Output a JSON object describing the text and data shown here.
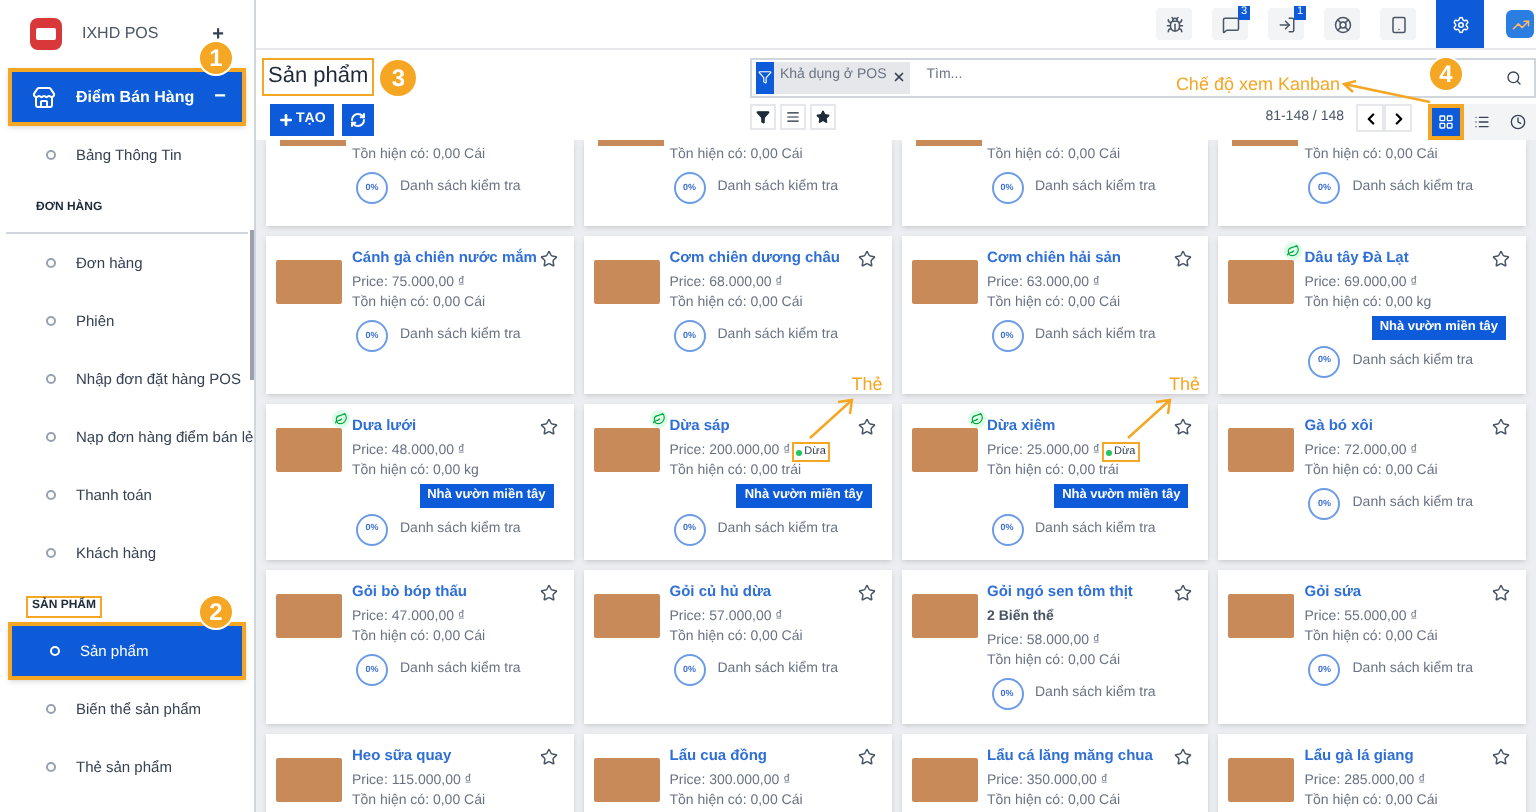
{
  "sidebar": {
    "app_name": "IXHD POS",
    "add_symbol": "+",
    "module": {
      "label": "Điểm Bán Hàng",
      "toggle": "−",
      "selected": true,
      "highlighted": true,
      "callout": "1"
    },
    "items": [
      {
        "kind": "link",
        "label": "Bảng Thông Tin",
        "selected": false
      },
      {
        "kind": "heading",
        "label": "ĐƠN HÀNG",
        "highlighted": false
      },
      {
        "kind": "link",
        "label": "Đơn hàng",
        "selected": false
      },
      {
        "kind": "link",
        "label": "Phiên",
        "selected": false
      },
      {
        "kind": "link",
        "label": "Nhập đơn đặt hàng POS",
        "selected": false
      },
      {
        "kind": "link",
        "label": "Nạp đơn hàng điểm bán lẻ",
        "selected": false
      },
      {
        "kind": "link",
        "label": "Thanh toán",
        "selected": false
      },
      {
        "kind": "link",
        "label": "Khách hàng",
        "selected": false
      },
      {
        "kind": "heading",
        "label": "SẢN PHẨM",
        "highlighted": true
      },
      {
        "kind": "link",
        "label": "Sản phẩm",
        "selected": true,
        "highlighted": true,
        "callout": "2"
      },
      {
        "kind": "link",
        "label": "Biến thể sản phẩm",
        "selected": false
      },
      {
        "kind": "link",
        "label": "Thẻ sản phẩm",
        "selected": false
      }
    ]
  },
  "toolbar": [
    {
      "kind": "bug",
      "selected": false
    },
    {
      "kind": "chat",
      "badge": "3",
      "selected": false
    },
    {
      "kind": "activity",
      "badge": "1",
      "selected": false
    },
    {
      "kind": "support",
      "selected": false
    },
    {
      "kind": "tablet",
      "selected": false
    },
    {
      "kind": "settings",
      "selected": true
    },
    {
      "kind": "chart",
      "selected": false
    }
  ],
  "page": {
    "title": "Sản phẩm",
    "title_highlighted": true,
    "title_callout": "3",
    "create_button": "TẠO",
    "search": {
      "facet": "Khả dụng ở POS",
      "placeholder": "Tìm..."
    },
    "pager": "81-148 / 148",
    "views": [
      {
        "kind": "kanban",
        "selected": true,
        "highlighted": true,
        "callout": "4",
        "note": "Chế độ xem Kanban"
      },
      {
        "kind": "list",
        "selected": false
      },
      {
        "kind": "activity",
        "selected": false
      }
    ]
  },
  "products": [
    {
      "kind": "cut_top",
      "stock": "Tồn hiện có: 0,00 Cái",
      "checklist": "0%",
      "checklist_label": "Danh sách kiểm tra"
    },
    {
      "kind": "cut_top",
      "stock": "Tồn hiện có: 0,00 Cái",
      "checklist": "0%",
      "checklist_label": "Danh sách kiểm tra"
    },
    {
      "kind": "cut_top",
      "stock": "Tồn hiện có: 0,00 Cái",
      "checklist": "0%",
      "checklist_label": "Danh sách kiểm tra"
    },
    {
      "kind": "cut_top",
      "stock": "Tồn hiện có: 0,00 Cái",
      "checklist": "0%",
      "checklist_label": "Danh sách kiểm tra"
    },
    {
      "kind": "full",
      "name": "Cánh gà chiên nước mắm",
      "organic": false,
      "price": "Price: 75.000,00 ₫",
      "stock": "Tồn hiện có: 0,00 Cái",
      "checklist": "0%",
      "checklist_label": "Danh sách kiểm tra"
    },
    {
      "kind": "full",
      "name": "Cơm chiên dương châu",
      "organic": false,
      "price": "Price: 68.000,00 ₫",
      "stock": "Tồn hiện có: 0,00 Cái",
      "checklist": "0%",
      "checklist_label": "Danh sách kiểm tra"
    },
    {
      "kind": "full",
      "name": "Cơm chiên hải sản",
      "organic": false,
      "price": "Price: 63.000,00 ₫",
      "stock": "Tồn hiện có: 0,00 Cái",
      "checklist": "0%",
      "checklist_label": "Danh sách kiểm tra"
    },
    {
      "kind": "full",
      "name": "Dâu tây Đà Lạt",
      "organic": true,
      "price": "Price: 69.000,00 ₫",
      "stock": "Tồn hiện có: 0,00 kg",
      "badge": "Nhà vườn miền tây",
      "checklist": "0%",
      "checklist_label": "Danh sách kiểm tra"
    },
    {
      "kind": "full",
      "name": "Dưa lưới",
      "organic": true,
      "price": "Price: 48.000,00 ₫",
      "stock": "Tồn hiện có: 0,00 kg",
      "badge": "Nhà vườn miền tây",
      "checklist": "0%",
      "checklist_label": "Danh sách kiểm tra"
    },
    {
      "kind": "full",
      "name": "Dừa sáp",
      "organic": true,
      "price": "Price: 200.000,00 ₫",
      "tag": {
        "label": "Dừa",
        "color": "#22c55e",
        "highlighted": true
      },
      "stock": "Tồn hiện có: 0,00 trái",
      "badge": "Nhà vườn miền tây",
      "checklist": "0%",
      "checklist_label": "Danh sách kiểm tra"
    },
    {
      "kind": "full",
      "name": "Dừa xiêm",
      "organic": true,
      "price": "Price: 25.000,00 ₫",
      "tag": {
        "label": "Dừa",
        "color": "#22c55e",
        "highlighted": true
      },
      "stock": "Tồn hiện có: 0,00 trái",
      "badge": "Nhà vườn miền tây",
      "checklist": "0%",
      "checklist_label": "Danh sách kiểm tra"
    },
    {
      "kind": "full",
      "name": "Gà bó xôi",
      "organic": false,
      "price": "Price: 72.000,00 ₫",
      "stock": "Tồn hiện có: 0,00 Cái",
      "checklist": "0%",
      "checklist_label": "Danh sách kiểm tra"
    },
    {
      "kind": "full",
      "name": "Gỏi bò bóp thấu",
      "organic": false,
      "price": "Price: 47.000,00 ₫",
      "stock": "Tồn hiện có: 0,00 Cái",
      "checklist": "0%",
      "checklist_label": "Danh sách kiểm tra"
    },
    {
      "kind": "full",
      "name": "Gỏi củ hủ dừa",
      "organic": false,
      "price": "Price: 57.000,00 ₫",
      "stock": "Tồn hiện có: 0,00 Cái",
      "checklist": "0%",
      "checklist_label": "Danh sách kiểm tra"
    },
    {
      "kind": "full",
      "name": "Gỏi ngó sen tôm thịt",
      "organic": false,
      "variants": "2 Biến thể",
      "price": "Price: 58.000,00 ₫",
      "stock": "Tồn hiện có: 0,00 Cái",
      "checklist": "0%",
      "checklist_label": "Danh sách kiểm tra"
    },
    {
      "kind": "full",
      "name": "Gỏi sứa",
      "organic": false,
      "price": "Price: 55.000,00 ₫",
      "stock": "Tồn hiện có: 0,00 Cái",
      "checklist": "0%",
      "checklist_label": "Danh sách kiểm tra"
    },
    {
      "kind": "cut_bottom",
      "name": "Heo sữa quay",
      "organic": false,
      "price": "Price: 115.000,00 ₫",
      "stock": "Tồn hiện có: 0,00 Cái"
    },
    {
      "kind": "cut_bottom",
      "name": "Lẩu cua đồng",
      "organic": false,
      "price": "Price: 300.000,00 ₫",
      "stock": "Tồn hiện có: 0,00 Cái"
    },
    {
      "kind": "cut_bottom",
      "name": "Lẩu cá lăng măng chua",
      "organic": false,
      "price": "Price: 350.000,00 ₫",
      "stock": "Tồn hiện có: 0,00 Cái"
    },
    {
      "kind": "cut_bottom",
      "name": "Lẩu gà lá giang",
      "organic": false,
      "price": "Price: 285.000,00 ₫",
      "stock": "Tồn hiện có: 0,00 Cái"
    }
  ],
  "tag_callouts": [
    {
      "text": "Thẻ"
    },
    {
      "text": "Thẻ"
    }
  ]
}
